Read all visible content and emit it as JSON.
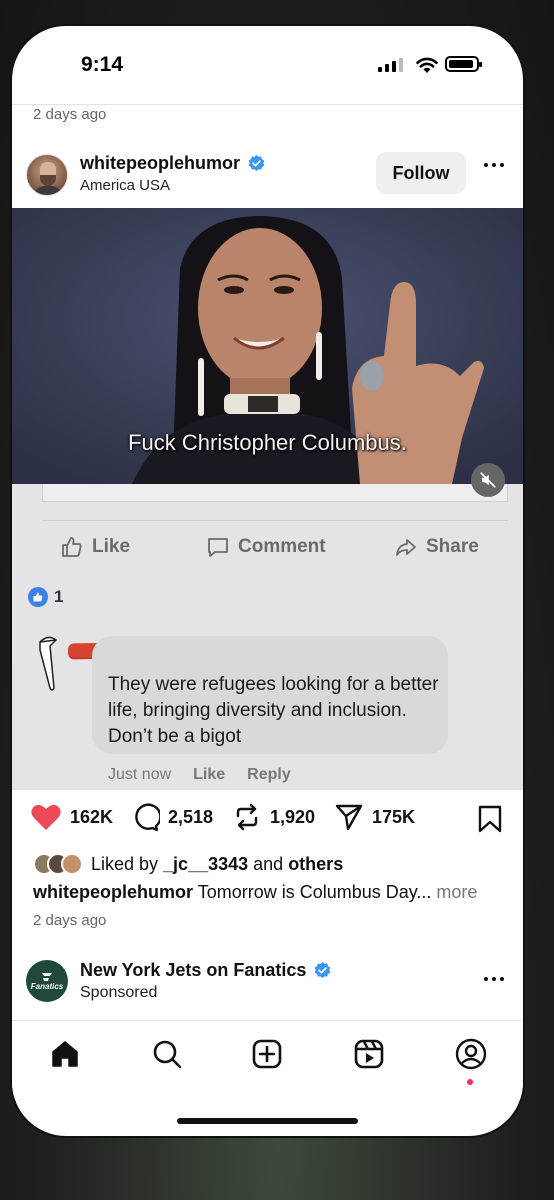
{
  "status_bar": {
    "time": "9:14"
  },
  "previous_post": {
    "timestamp": "2 days ago"
  },
  "post": {
    "username": "whitepeoplehumor",
    "location": "America USA",
    "follow_label": "Follow",
    "meme_caption": "Fuck Christopher Columbus.",
    "fb": {
      "like_label": "Like",
      "comment_label": "Comment",
      "share_label": "Share",
      "reaction_count": "1",
      "comment_text": "They were refugees looking for a better life, bringing diversity and inclusion. Don’t be a bigot",
      "comment_time": "Just now",
      "comment_like": "Like",
      "comment_reply": "Reply"
    },
    "likes_count": "162K",
    "comments_count": "2,518",
    "reposts_count": "1,920",
    "shares_count": "175K",
    "liked_by_prefix": "Liked by ",
    "liked_by_user": "_jc__3343",
    "liked_by_mid": " and ",
    "liked_by_others": "others",
    "caption_user": "whitepeoplehumor",
    "caption_text": " Tomorrow is Columbus Day...",
    "caption_more": " more",
    "timestamp": "2 days ago"
  },
  "sponsored": {
    "name": "New York Jets on Fanatics",
    "sub": "Sponsored",
    "logo_text": "Fanatics"
  },
  "colors": {
    "heart": "#ed4956",
    "verified": "#3897f0",
    "fb_blue": "#3b82e6"
  }
}
